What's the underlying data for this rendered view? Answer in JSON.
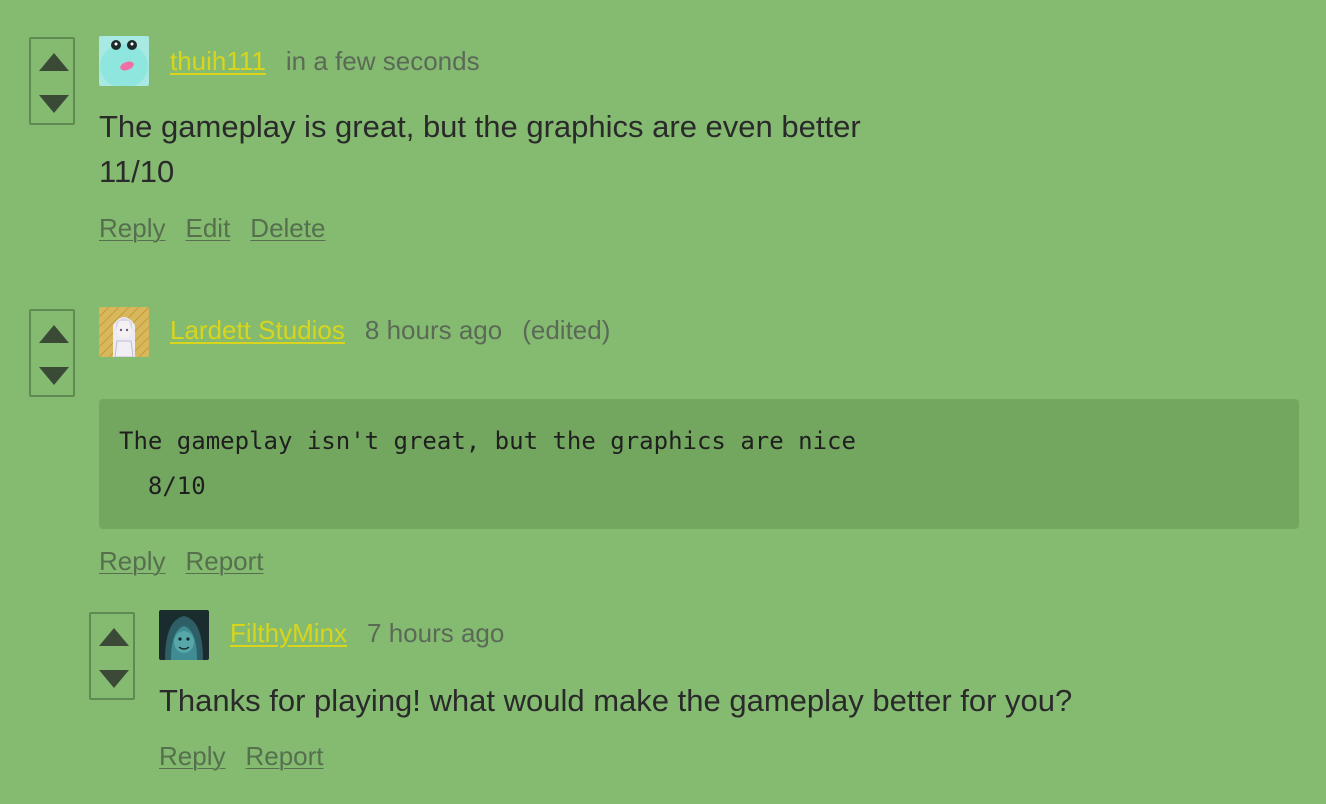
{
  "comments": [
    {
      "username": "thuih111",
      "time": "in a few seconds",
      "body_lines": [
        "The gameplay is great, but the graphics are even better",
        "11/10"
      ],
      "actions": [
        "Reply",
        "Edit",
        "Delete"
      ],
      "avatar_icon": "frog-avatar-icon"
    },
    {
      "username": "Lardett Studios",
      "time": "8 hours ago",
      "edited": "(edited)",
      "code_lines": [
        "The gameplay isn't great, but the graphics are nice",
        "  8/10"
      ],
      "actions": [
        "Reply",
        "Report"
      ],
      "avatar_icon": "anime-girl-avatar-icon"
    },
    {
      "username": "FilthyMinx",
      "time": "7 hours ago",
      "body_lines": [
        "Thanks for playing! what would make the gameplay better for you?"
      ],
      "actions": [
        "Reply",
        "Report"
      ],
      "avatar_icon": "hooded-figure-avatar-icon"
    }
  ],
  "colors": {
    "background": "#84bb71",
    "username": "#d9d51c",
    "code_background": "#73a75f",
    "vote_arrow": "#3b4a37"
  }
}
